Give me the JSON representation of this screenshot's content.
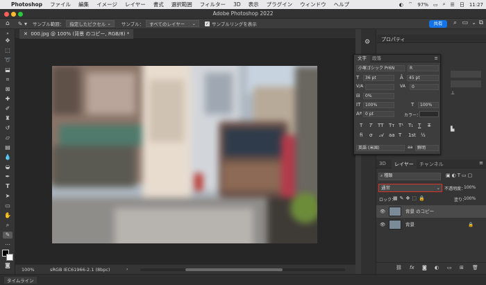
{
  "menubar": {
    "app": "Photoshop",
    "items": [
      "ファイル",
      "編集",
      "イメージ",
      "レイヤー",
      "書式",
      "選択範囲",
      "フィルター",
      "3D",
      "表示",
      "プラグイン",
      "ウィンドウ",
      "ヘルプ"
    ],
    "battery": "97%",
    "date": "日",
    "time": "11:27"
  },
  "window": {
    "title": "Adobe Photoshop 2022"
  },
  "options": {
    "sample_size_label": "サンプル範囲：",
    "sample_size_value": "指定したピクセル",
    "sample_label": "サンプル：",
    "sample_value": "すべてのレイヤー",
    "show_ring_label": "サンプルリングを表示",
    "share_label": "共有"
  },
  "document": {
    "tab_title": "000.jpg @ 100% (背景 のコピー, RGB/8) *"
  },
  "status": {
    "zoom": "100%",
    "profile": "sRGB IEC61966-2.1 (8bpc)"
  },
  "bottom": {
    "timeline_label": "タイムライン"
  },
  "properties": {
    "tab_label": "プロパティ"
  },
  "character": {
    "tab_character": "文字",
    "tab_paragraph": "段落",
    "font_family": "小塚ゴシック Pr6N",
    "font_style": "R",
    "font_size": "36 pt",
    "leading": "45 pt",
    "kerning": "",
    "tracking": "0",
    "tsume": "0%",
    "vertical_scale": "100%",
    "horizontal_scale": "100%",
    "baseline_shift": "0 pt",
    "color_label": "カラー：",
    "language": "英語 (米国)",
    "antialias": "鮮明",
    "glyphs": [
      "T",
      "T",
      "TT",
      "Tт",
      "T¹",
      "T₁",
      "T",
      "T"
    ]
  },
  "layers_panel": {
    "tabs": [
      "3D",
      "レイヤー",
      "チャンネル"
    ],
    "filter_label": "種類",
    "blend_mode": "通常",
    "opacity_label": "不透明度：",
    "opacity_value": "100%",
    "lock_label": "ロック：",
    "fill_label": "塗り：",
    "fill_value": "100%",
    "layers": [
      {
        "name": "背景 のコピー",
        "selected": true,
        "locked": false
      },
      {
        "name": "背景",
        "selected": false,
        "locked": true
      }
    ]
  },
  "colors": {
    "accent": "#1473e6",
    "highlight_box": "#d9352b",
    "panel_bg": "#353535",
    "canvas_bg": "#262626"
  }
}
